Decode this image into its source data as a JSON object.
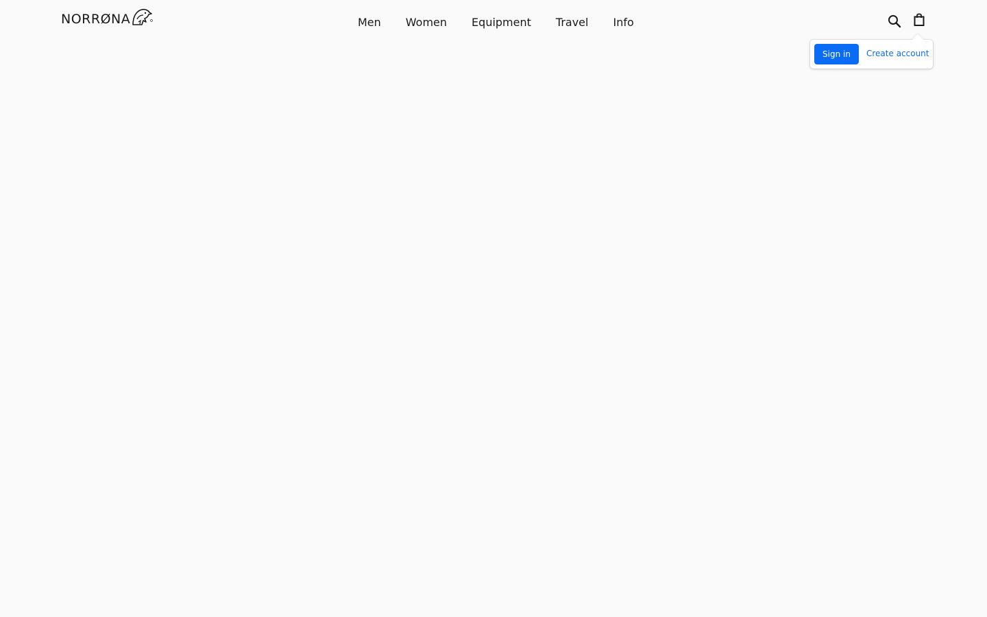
{
  "brand": {
    "name": "NORRØNA",
    "logo_icon": "bird-head-logo-icon"
  },
  "nav": {
    "items": [
      {
        "label": "Men"
      },
      {
        "label": "Women"
      },
      {
        "label": "Equipment"
      },
      {
        "label": "Travel"
      },
      {
        "label": "Info"
      }
    ]
  },
  "header": {
    "search_icon": "search-icon",
    "cart_icon": "shopping-bag-icon"
  },
  "account_popover": {
    "sign_in_label": "Sign in",
    "create_account_label": "Create account"
  },
  "colors": {
    "accent": "#0a6cf5",
    "background": "#fafafa",
    "text": "#1a1a1a"
  }
}
